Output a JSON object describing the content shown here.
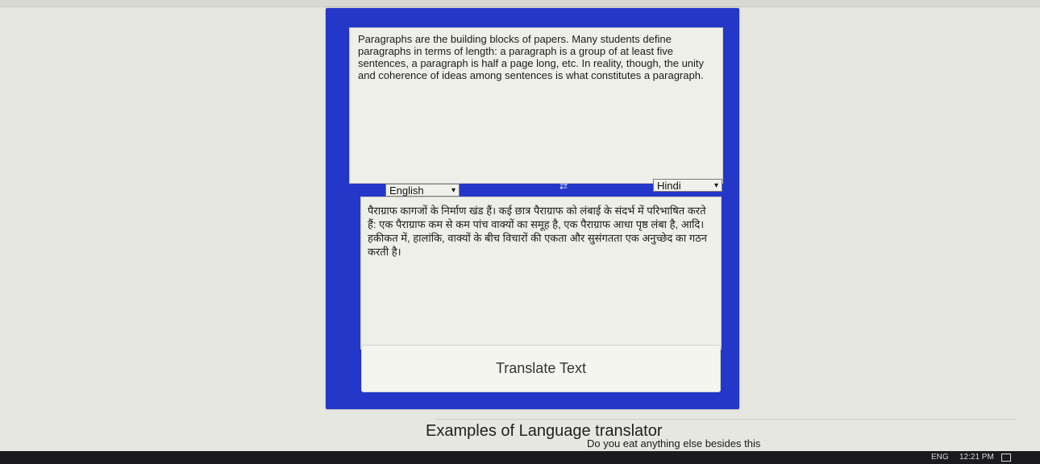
{
  "translator": {
    "source_text": "Paragraphs are the building blocks of papers. Many students define paragraphs in terms of length: a paragraph is a group of at least five sentences, a paragraph is half a page long, etc. In reality, though, the unity and coherence of ideas among sentences is what constitutes a paragraph.",
    "target_text": "पैराग्राफ कागजों के निर्माण खंड हैं। कई छात्र पैराग्राफ को लंबाई के संदर्भ में परिभाषित करते हैं: एक पैराग्राफ कम से कम पांच वाक्यों का समूह है, एक पैराग्राफ आधा पृष्ठ लंबा है, आदि। हकीकत में, हालांकि, वाक्यों के बीच विचारों की एकता और सुसंगतता एक अनुच्छेद का गठन करती है।",
    "from_language": "English",
    "to_language": "Hindi",
    "button_label": "Translate Text",
    "accent_color": "#2437c8"
  },
  "examples": {
    "heading": "Examples of Language translator",
    "first_item": "Do you eat anything else besides this"
  },
  "taskbar": {
    "language": "ENG",
    "time": "12:21 PM"
  }
}
